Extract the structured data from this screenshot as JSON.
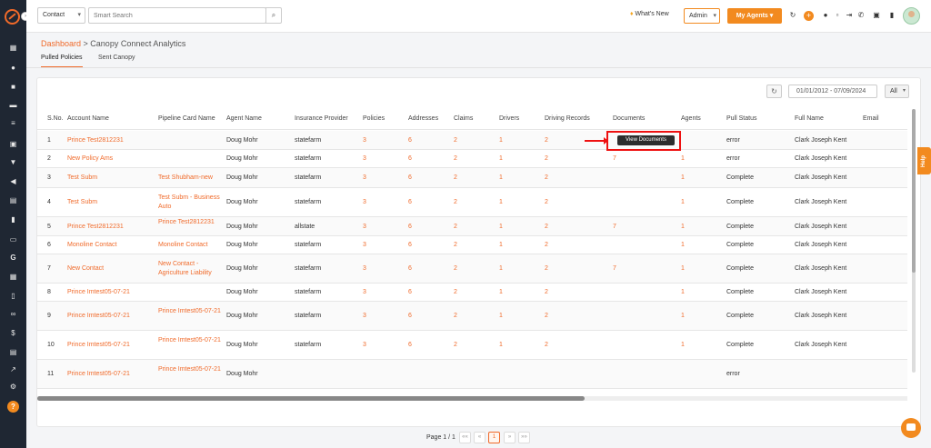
{
  "topbar": {
    "search_type": "Contact",
    "search_placeholder": "Smart Search",
    "whats_new": "What's New",
    "admin_label": "Admin",
    "my_agents_label": "My Agents"
  },
  "breadcrumb": {
    "root": "Dashboard",
    "sep": " > ",
    "current": "Canopy Connect Analytics"
  },
  "tabs": [
    "Pulled Policies",
    "Sent Canopy"
  ],
  "filters": {
    "date_range": "01/01/2012 - 07/09/2024",
    "status": "All"
  },
  "table": {
    "headers": [
      "S.No.",
      "Account Name",
      "Pipeline Card Name",
      "Agent Name",
      "Insurance Provider",
      "Policies",
      "Addresses",
      "Claims",
      "Drivers",
      "Driving Records",
      "Documents",
      "Agents",
      "Pull Status",
      "Full Name",
      "Email"
    ],
    "rows": [
      {
        "sno": "1",
        "account": "Prince Test2812231",
        "pipeline": "",
        "agent": "Doug Mohr",
        "provider": "statefarm",
        "policies": "3",
        "addresses": "6",
        "claims": "2",
        "drivers": "1",
        "driving": "2",
        "documents": "",
        "agents": "",
        "status": "error",
        "fullname": "Clark Joseph Kent"
      },
      {
        "sno": "2",
        "account": "New Policy Ams",
        "pipeline": "",
        "agent": "Doug Mohr",
        "provider": "statefarm",
        "policies": "3",
        "addresses": "6",
        "claims": "2",
        "drivers": "1",
        "driving": "2",
        "documents": "7",
        "agents": "1",
        "status": "error",
        "fullname": "Clark Joseph Kent"
      },
      {
        "sno": "3",
        "account": "Test Subm",
        "pipeline": "Test Shubham-new",
        "agent": "Doug Mohr",
        "provider": "statefarm",
        "policies": "3",
        "addresses": "6",
        "claims": "2",
        "drivers": "1",
        "driving": "2",
        "documents": "",
        "agents": "1",
        "status": "Complete",
        "fullname": "Clark Joseph Kent"
      },
      {
        "sno": "4",
        "account": "Test Subm",
        "pipeline": "Test Subm - Business Auto",
        "agent": "Doug Mohr",
        "provider": "statefarm",
        "policies": "3",
        "addresses": "6",
        "claims": "2",
        "drivers": "1",
        "driving": "2",
        "documents": "",
        "agents": "1",
        "status": "Complete",
        "fullname": "Clark Joseph Kent"
      },
      {
        "sno": "5",
        "account": "Prince Test2812231",
        "pipeline": "Prince Test2812231",
        "agent": "Doug Mohr",
        "provider": "allstate",
        "policies": "3",
        "addresses": "6",
        "claims": "2",
        "drivers": "1",
        "driving": "2",
        "documents": "7",
        "agents": "1",
        "status": "Complete",
        "fullname": "Clark Joseph Kent"
      },
      {
        "sno": "6",
        "account": "Monoline Contact",
        "pipeline": "Monoline Contact",
        "agent": "Doug Mohr",
        "provider": "statefarm",
        "policies": "3",
        "addresses": "6",
        "claims": "2",
        "drivers": "1",
        "driving": "2",
        "documents": "",
        "agents": "1",
        "status": "Complete",
        "fullname": "Clark Joseph Kent"
      },
      {
        "sno": "7",
        "account": "New Contact",
        "pipeline": "New Contact - Agriculture Liability",
        "agent": "Doug Mohr",
        "provider": "statefarm",
        "policies": "3",
        "addresses": "6",
        "claims": "2",
        "drivers": "1",
        "driving": "2",
        "documents": "7",
        "agents": "1",
        "status": "Complete",
        "fullname": "Clark Joseph Kent"
      },
      {
        "sno": "8",
        "account": "Prince Imtest05-07-21",
        "pipeline": "",
        "agent": "Doug Mohr",
        "provider": "statefarm",
        "policies": "3",
        "addresses": "6",
        "claims": "2",
        "drivers": "1",
        "driving": "2",
        "documents": "",
        "agents": "1",
        "status": "Complete",
        "fullname": "Clark Joseph Kent"
      },
      {
        "sno": "9",
        "account": "Prince Imtest05-07-21",
        "pipeline": "Prince Imtest05-07-21",
        "agent": "Doug Mohr",
        "provider": "statefarm",
        "policies": "3",
        "addresses": "6",
        "claims": "2",
        "drivers": "1",
        "driving": "2",
        "documents": "",
        "agents": "1",
        "status": "Complete",
        "fullname": "Clark Joseph Kent"
      },
      {
        "sno": "10",
        "account": "Prince Imtest05-07-21",
        "pipeline": "Prince Imtest05-07-21",
        "agent": "Doug Mohr",
        "provider": "statefarm",
        "policies": "3",
        "addresses": "6",
        "claims": "2",
        "drivers": "1",
        "driving": "2",
        "documents": "",
        "agents": "1",
        "status": "Complete",
        "fullname": "Clark Joseph Kent"
      },
      {
        "sno": "11",
        "account": "Prince Imtest05-07-21",
        "pipeline": "Prince Imtest05-07-21",
        "agent": "Doug Mohr",
        "provider": "",
        "policies": "",
        "addresses": "",
        "claims": "",
        "drivers": "",
        "driving": "",
        "documents": "",
        "agents": "",
        "status": "error",
        "fullname": ""
      }
    ]
  },
  "tooltip": "View Documents",
  "pagination": {
    "label": "Page 1 / 1",
    "first": "««",
    "prev": "«",
    "current": "1",
    "next": "»",
    "last": "»»"
  },
  "help_tab": "Help",
  "colors": {
    "accent": "#f06a2a",
    "sidebar": "#1f2733",
    "highlight": "#e11111"
  }
}
